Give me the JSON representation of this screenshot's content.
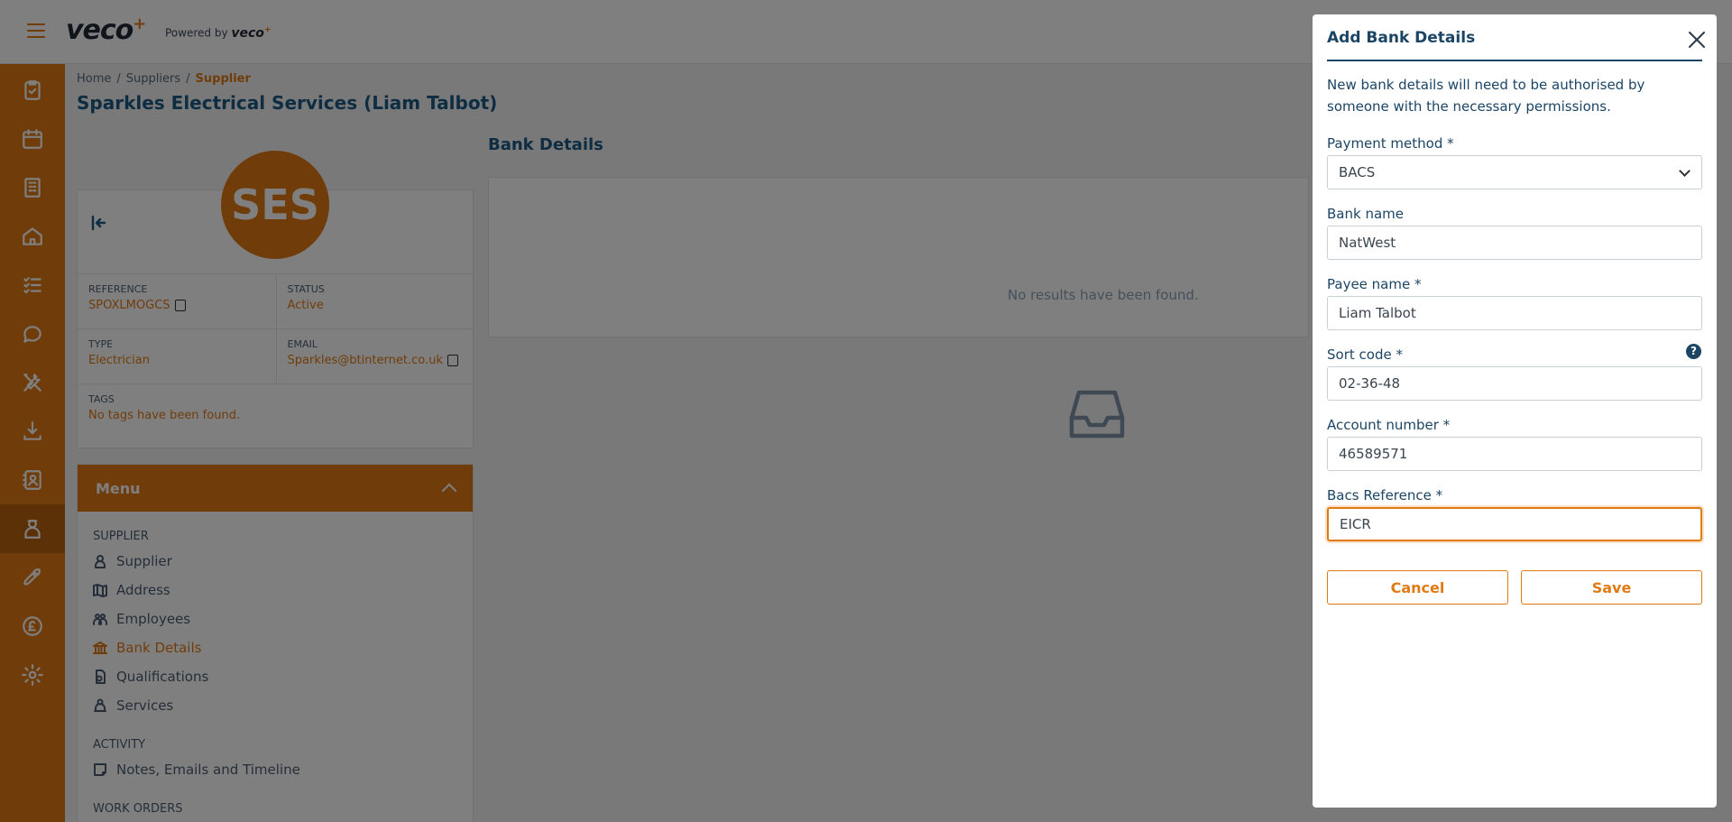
{
  "brand": {
    "logo_text": "veco",
    "powered_by_label": "Powered by",
    "powered_by_brand": "veco",
    "accent_color": "#e07b14",
    "primary_color": "#1c5a86"
  },
  "breadcrumb": {
    "items": [
      "Home",
      "Suppliers"
    ],
    "current": "Supplier",
    "separator": "/"
  },
  "page": {
    "title": "Sparkles Electrical Services (Liam Talbot)"
  },
  "profile": {
    "avatar_initials": "SES",
    "reference_label": "REFERENCE",
    "reference_value": "SPOXLMOGCS",
    "status_label": "STATUS",
    "status_value": "Active",
    "type_label": "TYPE",
    "type_value": "Electrician",
    "email_label": "EMAIL",
    "email_value": "Sparkles@btinternet.co.uk",
    "tags_label": "TAGS",
    "tags_value": "No tags have been found."
  },
  "menu": {
    "title": "Menu",
    "section_supplier": "SUPPLIER",
    "items": [
      {
        "label": "Supplier",
        "icon": "person-icon"
      },
      {
        "label": "Address",
        "icon": "map-icon"
      },
      {
        "label": "Employees",
        "icon": "people-icon"
      },
      {
        "label": "Bank Details",
        "icon": "bank-icon",
        "active": true
      },
      {
        "label": "Qualifications",
        "icon": "certificate-icon"
      },
      {
        "label": "Services",
        "icon": "service-icon"
      }
    ],
    "section_activity": "ACTIVITY",
    "activity_item": "Notes, Emails and Timeline",
    "section_work_orders": "WORK ORDERS"
  },
  "bank_details": {
    "title": "Bank Details",
    "empty_message": "No results have been found."
  },
  "modal": {
    "title": "Add Bank Details",
    "description": "New bank details will need to be authorised by someone with the necessary permissions.",
    "payment_method_label": "Payment method *",
    "payment_method_value": "BACS",
    "bank_name_label": "Bank name",
    "bank_name_value": "NatWest",
    "payee_name_label": "Payee name *",
    "payee_name_value": "Liam Talbot",
    "sort_code_label": "Sort code *",
    "sort_code_value": "02-36-48",
    "account_number_label": "Account number *",
    "account_number_value": "46589571",
    "bacs_reference_label": "Bacs Reference *",
    "bacs_reference_value": "EICR",
    "help_glyph": "?",
    "cancel_label": "Cancel",
    "save_label": "Save"
  }
}
